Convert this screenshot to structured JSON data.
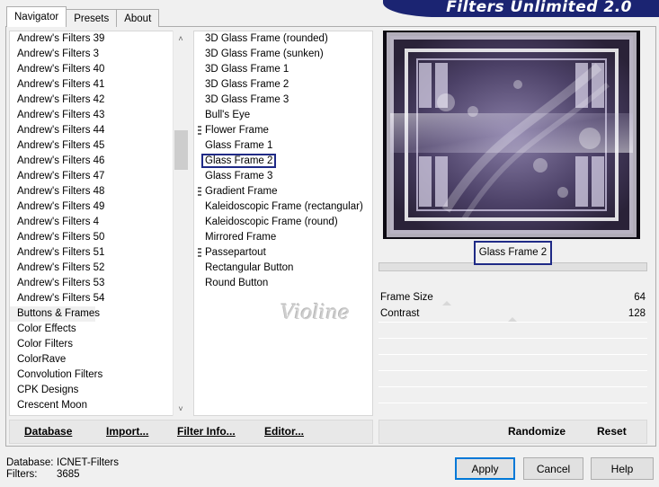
{
  "banner": {
    "title": "Filters Unlimited 2.0"
  },
  "tabs": [
    {
      "label": "Navigator"
    },
    {
      "label": "Presets"
    },
    {
      "label": "About"
    }
  ],
  "categories": [
    "Andrew's Filters 39",
    "Andrew's Filters 3",
    "Andrew's Filters 40",
    "Andrew's Filters 41",
    "Andrew's Filters 42",
    "Andrew's Filters 43",
    "Andrew's Filters 44",
    "Andrew's Filters 45",
    "Andrew's Filters 46",
    "Andrew's Filters 47",
    "Andrew's Filters 48",
    "Andrew's Filters 49",
    "Andrew's Filters 4",
    "Andrew's Filters 50",
    "Andrew's Filters 51",
    "Andrew's Filters 52",
    "Andrew's Filters 53",
    "Andrew's Filters 54",
    "Buttons & Frames",
    "Color Effects",
    "Color Filters",
    "ColorRave",
    "Convolution Filters",
    "CPK Designs",
    "Crescent Moon"
  ],
  "selected_category": "Buttons & Frames",
  "filters": [
    {
      "label": "3D Glass Frame (rounded)",
      "grip": false
    },
    {
      "label": "3D Glass Frame (sunken)",
      "grip": false
    },
    {
      "label": "3D Glass Frame 1",
      "grip": false
    },
    {
      "label": "3D Glass Frame 2",
      "grip": false
    },
    {
      "label": "3D Glass Frame 3",
      "grip": false
    },
    {
      "label": "Bull's Eye",
      "grip": false
    },
    {
      "label": "Flower Frame",
      "grip": true
    },
    {
      "label": "Glass Frame 1",
      "grip": false
    },
    {
      "label": "Glass Frame 2",
      "grip": false
    },
    {
      "label": "Glass Frame 3",
      "grip": false
    },
    {
      "label": "Gradient Frame",
      "grip": true
    },
    {
      "label": "Kaleidoscopic Frame (rectangular)",
      "grip": false
    },
    {
      "label": "Kaleidoscopic Frame (round)",
      "grip": false
    },
    {
      "label": "Mirrored Frame",
      "grip": false
    },
    {
      "label": "Passepartout",
      "grip": true
    },
    {
      "label": "Rectangular Button",
      "grip": false
    },
    {
      "label": "Round Button",
      "grip": false
    }
  ],
  "selected_filter": "Glass Frame 2",
  "preview": {
    "label": "Glass Frame 2"
  },
  "params": [
    {
      "name": "Frame Size",
      "value": "64"
    },
    {
      "name": "Contrast",
      "value": "128"
    }
  ],
  "toolbar_left": {
    "database": "Database",
    "import": "Import...",
    "filter_info": "Filter Info...",
    "editor": "Editor..."
  },
  "toolbar_right": {
    "randomize": "Randomize",
    "reset": "Reset"
  },
  "status": {
    "database_label": "Database:",
    "database_value": "ICNET-Filters",
    "filters_label": "Filters:",
    "filters_value": "3685"
  },
  "buttons": {
    "apply": "Apply",
    "cancel": "Cancel",
    "help": "Help"
  },
  "watermark": "Violine",
  "colors": {
    "accent": "#1f2a86",
    "banner": "#1b2472"
  }
}
